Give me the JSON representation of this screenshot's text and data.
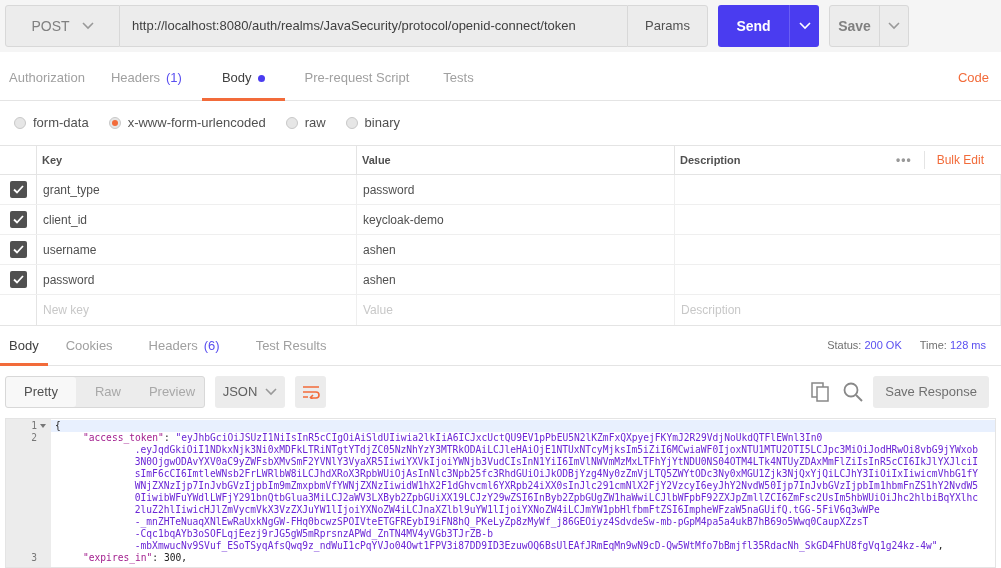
{
  "request": {
    "method": "POST",
    "url": "http://localhost:8080/auth/realms/JavaSecurity/protocol/openid-connect/token",
    "params_button": "Params",
    "send_button": "Send",
    "save_button": "Save"
  },
  "request_tabs": [
    {
      "label": "Authorization",
      "selected": false
    },
    {
      "label": "Headers",
      "count": "(1)",
      "selected": false
    },
    {
      "label": "Body",
      "dot": true,
      "selected": true
    },
    {
      "label": "Pre-request Script",
      "selected": false
    },
    {
      "label": "Tests",
      "selected": false
    }
  ],
  "code_link": "Code",
  "body_types": [
    {
      "label": "form-data",
      "selected": false
    },
    {
      "label": "x-www-form-urlencoded",
      "selected": true
    },
    {
      "label": "raw",
      "selected": false
    },
    {
      "label": "binary",
      "selected": false
    }
  ],
  "params_table": {
    "columns": [
      "Key",
      "Value",
      "Description"
    ],
    "more": "•••",
    "bulk_edit": "Bulk Edit",
    "rows": [
      {
        "checked": true,
        "key": "grant_type",
        "value": "password"
      },
      {
        "checked": true,
        "key": "client_id",
        "value": "keycloak-demo"
      },
      {
        "checked": true,
        "key": "username",
        "value": "ashen"
      },
      {
        "checked": true,
        "key": "password",
        "value": "ashen"
      }
    ],
    "new_row": {
      "key": "New key",
      "value": "Value",
      "description": "Description"
    }
  },
  "response_tabs": [
    {
      "label": "Body",
      "selected": true
    },
    {
      "label": "Cookies",
      "selected": false
    },
    {
      "label": "Headers",
      "count": "(6)",
      "selected": false
    },
    {
      "label": "Test Results",
      "selected": false
    }
  ],
  "status": {
    "label": "Status:",
    "value": "200 OK"
  },
  "time": {
    "label": "Time:",
    "value": "128 ms"
  },
  "view_modes": [
    {
      "label": "Pretty",
      "selected": true
    },
    {
      "label": "Raw",
      "selected": false
    },
    {
      "label": "Preview",
      "selected": false
    }
  ],
  "format": "JSON",
  "save_response": "Save Response",
  "code": [
    {
      "number": "1",
      "fold": true,
      "current": true,
      "parts": [
        {
          "kind": "punct",
          "text": "{"
        }
      ],
      "children": [
        {
          "number": "2",
          "parts": [
            {
              "kind": "key",
              "text": "\"access_token\""
            },
            {
              "kind": "punct",
              "text": ": "
            },
            {
              "kind": "string",
              "text": "\"eyJhbGciOiJSUzI1NiIsInR5cCIgOiAiSldUIiwia2lkIiA6ICJxcUctQU9EV1pPbEU5N2lKZmFxQXpyejFKYmJ2R29VdjNoUkdQTFlEWnl3In0"
            }
          ],
          "wrapped": [
            [
              {
                "kind": "string",
                "text": ".eyJqdGkiOiI1NDkxNjk3Ni0xMDFkLTRiNTgtYTdjZC05NzNhYzY3MTRkODAiLCJleHAiOjE1NTUxNTcyMjksIm5iZiI6MCwiaWF0IjoxNTU1MTU2OTI5LCJpc3MiOiJodHRwOi8vbG9jYWxob"
              }
            ],
            [
              {
                "kind": "string",
                "text": "3N0OjgwODAvYXV0aC9yZWFsbXMvSmF2YVNlY3VyaXR5IiwiYXVkIjoiYWNjb3VudCIsInN1YiI6ImVlNWVmMzMxLTFhYjYtNDU0NS04OTM4LTk4NTUyZDAxMmFlZiIsInR5cCI6IkJlYXJlciI"
              }
            ],
            [
              {
                "kind": "string",
                "text": "sImF6cCI6ImtleWNsb2FrLWRlbW8iLCJhdXRoX3RpbWUiOjAsInNlc3Npb25fc3RhdGUiOiJkODBjYzg4Ny0zZmVjLTQ5ZWYtODc3Ny0xMGU1Zjk3NjQxYjQiLCJhY3IiOiIxIiwicmVhbG1fY"
              }
            ],
            [
              {
                "kind": "string",
                "text": "WNjZXNzIjp7InJvbGVzIjpbIm9mZmxpbmVfYWNjZXNzIiwidW1hX2F1dGhvcml6YXRpb24iXX0sInJlc291cmNlX2FjY2VzcyI6eyJhY2NvdW50Ijp7InJvbGVzIjpbIm1hbmFnZS1hY2NvdW5"
              }
            ],
            [
              {
                "kind": "string",
                "text": "0IiwibWFuYWdlLWFjY291bnQtbGlua3MiLCJ2aWV3LXByb2ZpbGUiXX19LCJzY29wZSI6InByb2ZpbGUgZW1haWwiLCJlbWFpbF92ZXJpZmllZCI6ZmFsc2UsIm5hbWUiOiJhc2hlbiBqYXlhc"
              }
            ],
            [
              {
                "kind": "string",
                "text": "2luZ2hlIiwicHJlZmVycmVkX3VzZXJuYW1lIjoiYXNoZW4iLCJnaXZlbl9uYW1lIjoiYXNoZW4iLCJmYW1pbHlfbmFtZSI6ImpheWFzaW5naGUifQ.tGG-5FiV6q3wWPe"
              }
            ],
            [
              {
                "kind": "string",
                "text": "-_mnZHTeNuaqXNlEwRaUxkNgGW-FHq0bcwzSPOIVteETGFREybI9iFN8hQ_PKeLyZp8zMyWf_j86GEOiyz4SdvdeSw-mb-pGpM4pa5a4ukB7hB69o5Wwq0CaupXZzsT"
              }
            ],
            [
              {
                "kind": "string",
                "text": "-Cqc1bqAYb3oSOFLqjEezj9rJG5gW5mRprsnzAPWd_ZnTN4MV4yVGb3TJrZB-b"
              }
            ],
            [
              {
                "kind": "string",
                "text": "-mbXmwucNv9SVuf_ESoTSyqAfsQwq9z_ndWuI1cPqYVJo04Owt1FPV3i87DD9ID3EzuwOQ6BsUlEAfJRmEqMn9wN9cD-Qw5WtMfo7bBmjfl35RdacNh_SkGD4FhU8fgVq1g24kz-4w\""
              },
              {
                "kind": "punct",
                "text": ","
              }
            ]
          ]
        },
        {
          "number": "3",
          "parts": [
            {
              "kind": "key",
              "text": "\"expires_in\""
            },
            {
              "kind": "punct",
              "text": ": "
            },
            {
              "kind": "number",
              "text": "300"
            },
            {
              "kind": "punct",
              "text": ","
            }
          ]
        }
      ]
    }
  ]
}
